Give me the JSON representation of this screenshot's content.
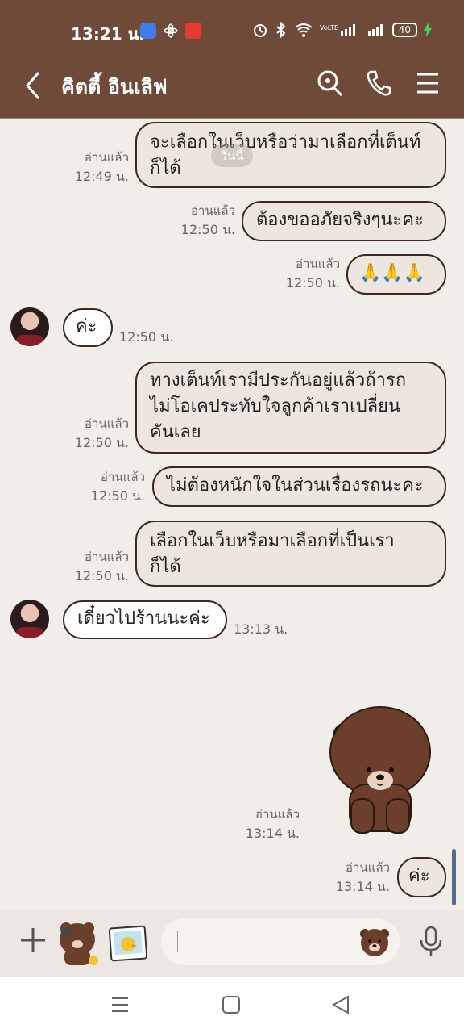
{
  "status_bar": {
    "time": "13:21 น.",
    "battery": "40"
  },
  "header": {
    "title": "คิตตี้ อินเลิฟ"
  },
  "chat": {
    "date_chip": "วันนี้",
    "messages": [
      {
        "text": "จะเลือกในเว็บหรือว่ามาเลือกที่เต็นท์\nก็ได้",
        "status": "อ่านแล้ว",
        "time": "12:49 น."
      },
      {
        "text": "ต้องขออภัยจริงๆนะคะ",
        "status": "อ่านแล้ว",
        "time": "12:50 น."
      },
      {
        "text": "🙏🙏🙏",
        "status": "อ่านแล้ว",
        "time": "12:50 น."
      },
      {
        "text": "ค่ะ",
        "time": "12:50 น."
      },
      {
        "text": "ทางเต็นท์เรามีประกันอยู่แล้วถ้ารถ\nไม่โอเคประทับใจลูกค้าเราเปลี่ยน\nคันเลย",
        "status": "อ่านแล้ว",
        "time": "12:50 น."
      },
      {
        "text": "ไม่ต้องหนักใจในส่วนเรื่องรถนะคะ",
        "status": "อ่านแล้ว",
        "time": "12:50 น."
      },
      {
        "text": "เลือกในเว็บหรือมาเลือกที่เป็นเรา\nก็ได้",
        "status": "อ่านแล้ว",
        "time": "12:50 น."
      },
      {
        "text": "เดี๋ยวไปร้านนะค่ะ",
        "time": "13:13 น."
      },
      {
        "sticker": "brown-bear-sticker",
        "status": "อ่านแล้ว",
        "time": "13:14 น."
      },
      {
        "text": "ค่ะ",
        "status": "อ่านแล้ว",
        "time": "13:14 น."
      }
    ]
  },
  "input": {
    "placeholder": ""
  },
  "colors": {
    "header_bg": "#6f4a38",
    "chat_bg": "#f1ede8",
    "bubble_out": "#ece6df",
    "bubble_border": "#3a2a22"
  }
}
